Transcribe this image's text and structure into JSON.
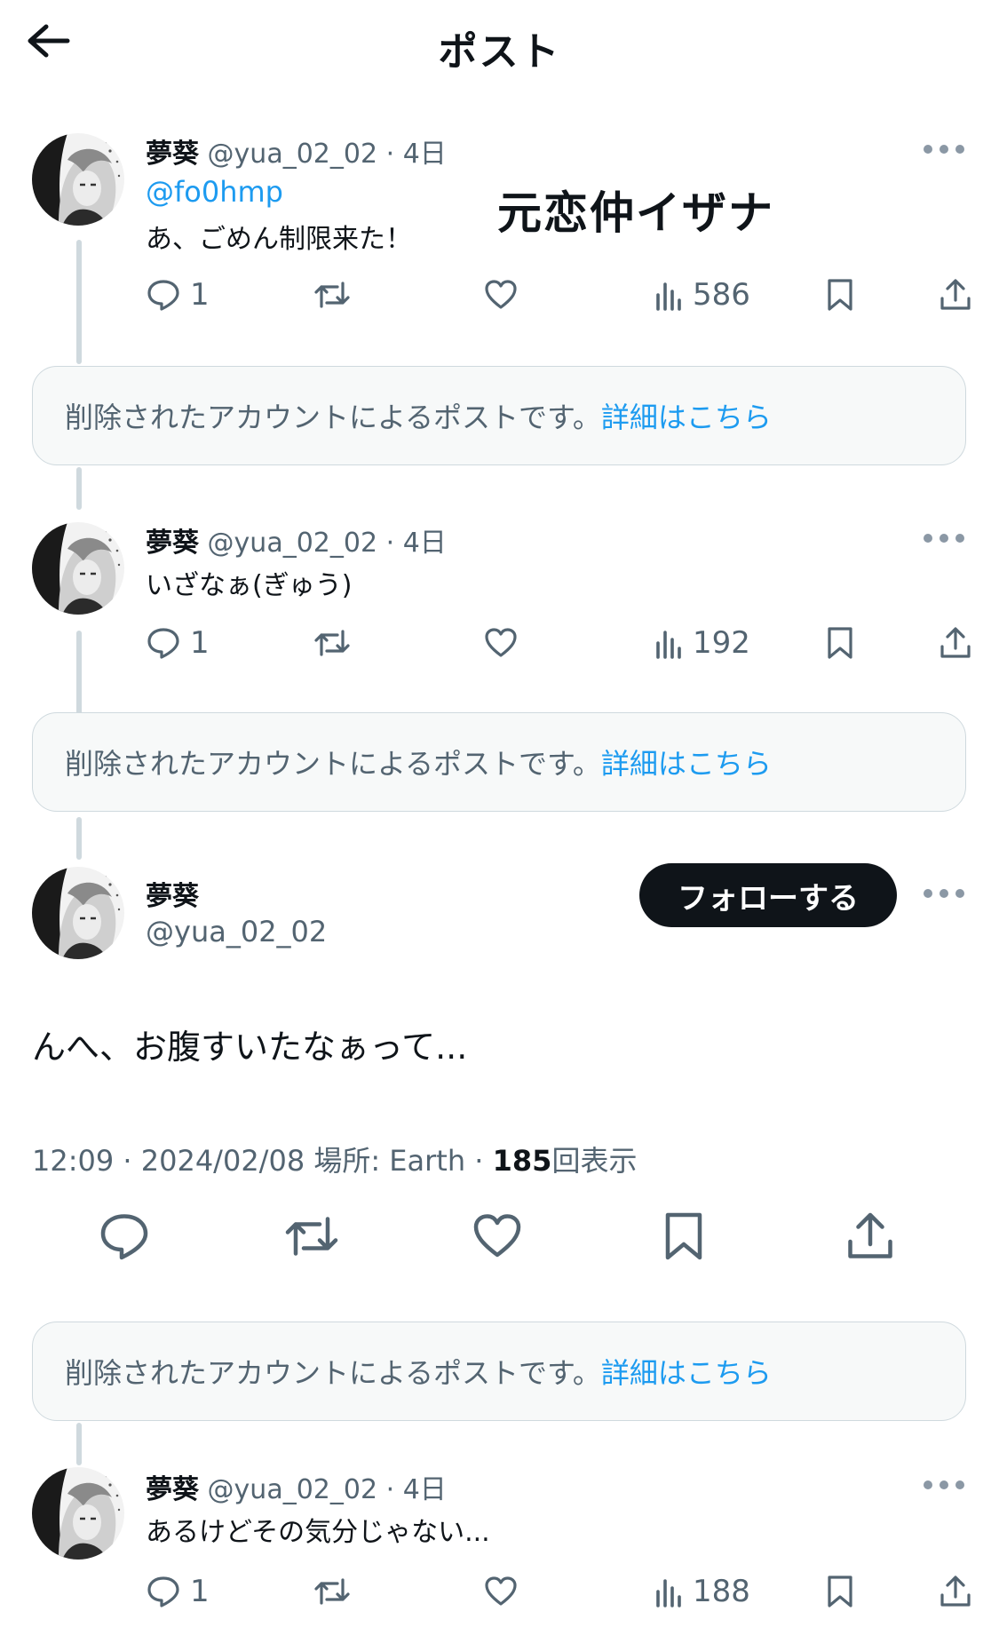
{
  "header": {
    "title": "ポスト"
  },
  "overlay_text": "元恋仲イザナ",
  "deleted_notice": {
    "text": "削除されたアカウントによるポストです。",
    "link": "詳細はこちら"
  },
  "posts": [
    {
      "display_name": "夢葵",
      "handle": "@yua_02_02",
      "sep": "·",
      "time": "4日",
      "mention": "@fo0hmp",
      "text": "あ、ごめん制限来た！",
      "reply_count": "1",
      "views": "586"
    },
    {
      "display_name": "夢葵",
      "handle": "@yua_02_02",
      "sep": "·",
      "time": "4日",
      "text": "いざなぁ(ぎゅう)",
      "reply_count": "1",
      "views": "192"
    },
    {
      "display_name": "夢葵",
      "handle": "@yua_02_02",
      "sep": "·",
      "time": "4日",
      "text": "あるけどその気分じゃない...",
      "reply_count": "1",
      "views": "188"
    }
  ],
  "main_post": {
    "display_name": "夢葵",
    "handle": "@yua_02_02",
    "follow_label": "フォローする",
    "text": "んへ、お腹すいたなぁって...",
    "time": "12:09",
    "date": "2024/02/08",
    "location": "場所: Earth",
    "views_count": "185",
    "views_label": "回表示",
    "sep": "·"
  },
  "icons": [
    "back-arrow-icon",
    "reply-icon",
    "repost-icon",
    "like-icon",
    "views-icon",
    "bookmark-icon",
    "share-icon",
    "more-icon"
  ],
  "colors": {
    "accent": "#1d9bf0",
    "text": "#0f1419",
    "secondary": "#536471",
    "line": "#cfd9de"
  }
}
